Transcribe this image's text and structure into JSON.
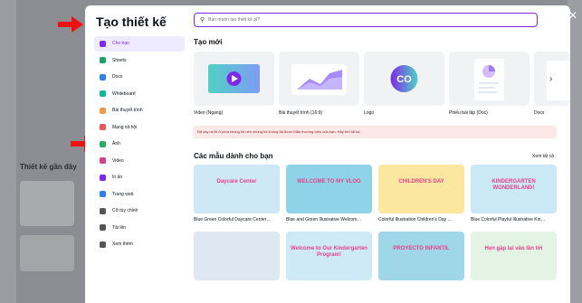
{
  "modal": {
    "title": "Tạo thiết kế",
    "search_placeholder": "Bạn muốn tạo thiết kế gì?"
  },
  "sidebar": {
    "items": [
      {
        "label": "Cho bạn",
        "color": "#7d2ae8",
        "icon": "sparkle-icon"
      },
      {
        "label": "Sheets",
        "color": "#19a463",
        "icon": "sheets-icon"
      },
      {
        "label": "Docs",
        "color": "#2f80ed",
        "icon": "docs-icon"
      },
      {
        "label": "Whiteboard",
        "color": "#13b59c",
        "icon": "whiteboard-icon"
      },
      {
        "label": "Bài thuyết trình",
        "color": "#f2994a",
        "icon": "presentation-icon"
      },
      {
        "label": "Mạng xã hội",
        "color": "#eb5757",
        "icon": "heart-icon"
      },
      {
        "label": "Ảnh",
        "color": "#27ae60",
        "icon": "photo-icon"
      },
      {
        "label": "Video",
        "color": "#d53f8c",
        "icon": "video-icon"
      },
      {
        "label": "In ấn",
        "color": "#7d2ae8",
        "icon": "print-icon"
      },
      {
        "label": "Trang web",
        "color": "#2f80ed",
        "icon": "website-icon"
      },
      {
        "label": "Cỡ tùy chỉnh",
        "color": "#555",
        "icon": "resize-icon"
      },
      {
        "label": "Tải lên",
        "color": "#555",
        "icon": "upload-icon"
      },
      {
        "label": "Xem thêm",
        "color": "#555",
        "icon": "more-icon"
      }
    ]
  },
  "create_new": {
    "title": "Tạo mới",
    "cards": [
      {
        "label": "Video (Ngang)"
      },
      {
        "label": "Bài thuyết trình (16:9)"
      },
      {
        "label": "Logo"
      },
      {
        "label": "Phiếu bài tập (Doc)"
      },
      {
        "label": "Docs"
      }
    ]
  },
  "error_text": "Đã xảy ra lỗi ở phía chúng tôi nên chúng tôi không tải được Mẫu thương hiệu của bạn. Hãy thử tải lại.",
  "for_you": {
    "title": "Các mẫu dành cho bạn",
    "see_all": "Xem tất cả",
    "templates": [
      {
        "label": "Blue Green Colorful Daycare Center…",
        "art": "Daycare Center",
        "bg": "#cfe8f5"
      },
      {
        "label": "Blue and Green Illustrative Welcom…",
        "art": "WELCOME TO MY VLOG",
        "bg": "#8fd3e8"
      },
      {
        "label": "Colorful Illustration Children's Day …",
        "art": "CHILDREN'S DAY",
        "bg": "#fbe7a0"
      },
      {
        "label": "Blue Colorful Playful Illustrative Kin…",
        "art": "KINDERGARTEN WONDERLAND!",
        "bg": "#c9e9f6"
      },
      {
        "label": "Sơ đồ tư duy",
        "art": "",
        "bg": "#dfe7f3"
      },
      {
        "label": "Blue and Orange Playful Kindergart…",
        "art": "Welcome to Our Kindergarten Program!",
        "bg": "#cfeaf7"
      },
      {
        "label": "Presentación proyecto para niños d…",
        "art": "PROYECTO INFANTIL",
        "bg": "#9fd6e8"
      },
      {
        "label": "Nhiều màu sắc Họa tiết và Hình dạ…",
        "art": "Hẹn gặp lại vào lần tới",
        "bg": "#e3f3e4"
      }
    ]
  },
  "background": {
    "section_title": "Thiết kế gần đây"
  }
}
